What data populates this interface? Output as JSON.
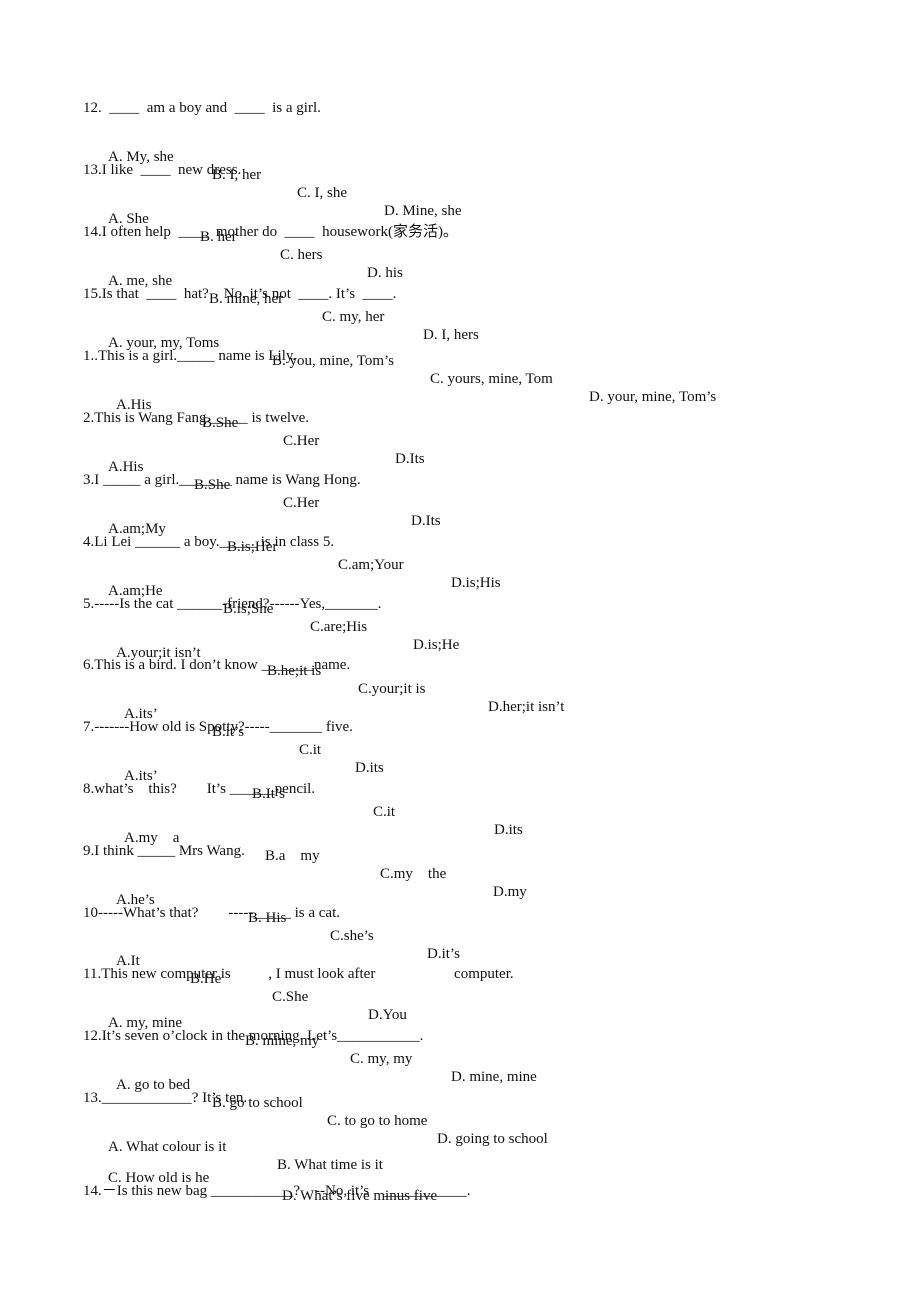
{
  "questions": [
    {
      "stem": "12.  ____  am a boy and  ____  is a girl.",
      "options": [
        "A. My, she",
        "B. I, her",
        "C. I, she",
        "D. Mine, she"
      ]
    },
    {
      "stem": "13.I like  ____  new dress.",
      "options": [
        "A. She",
        "B. her",
        "C. hers",
        "D. his"
      ]
    },
    {
      "stem": "14.I often help  ____  mother do  ____  housework(家务活)。",
      "options": [
        "A. me, she",
        "B. mine, her",
        "C. my, her",
        "D. I, hers"
      ]
    },
    {
      "stem": "15.Is that  ____  hat?    No, it’s not  ____. It’s  ____.",
      "options": [
        "A. your, my, Toms",
        "B. you, mine, Tom’s",
        "C. yours, mine, Tom",
        "D. your, mine, Tom’s"
      ]
    },
    {
      "stem": "1..This is a girl._____ name is Lily.",
      "options": [
        "A.His",
        "B.She",
        "C.Her",
        "D.Its"
      ]
    },
    {
      "stem": "2.This is Wang Fang._____ is twelve.",
      "options": [
        "A.His",
        "B.She",
        "C.Her",
        "D.Its"
      ]
    },
    {
      "stem": "3.I _____ a girl._______ name is Wang Hong.",
      "options": [
        "A.am;My",
        "B.is;Her",
        "C.am;Your",
        "D.is;His"
      ]
    },
    {
      "stem": "4.Li Lei ______ a boy._____ is in class 5.",
      "options": [
        "A.am;He",
        "B.is;She",
        "C.are;His",
        "D.is;He"
      ]
    },
    {
      "stem": "5.-----Is the cat ______-friend?------Yes,_______.",
      "options": [
        "A.your;it isn’t",
        "B.he;it is",
        "C.your;it is",
        "D.her;it isn’t"
      ]
    },
    {
      "stem": "6.This is a bird. I don’t know _______name.",
      "options": [
        "A.its’",
        "B.it’s",
        "C.it",
        "D.its"
      ]
    },
    {
      "stem": "7.-------How old is Spotty?-----_______ five.",
      "options": [
        "A.its’",
        "B.It’s",
        "C.it",
        "D.its"
      ]
    },
    {
      "stem": "8.what’s    this?        It’s ______pencil.",
      "options": [
        "A.my    a",
        "B.a    my",
        "C.my    the",
        "D.my"
      ]
    },
    {
      "stem": "9.I think _____ Mrs Wang.",
      "options": [
        "A.he’s",
        "B. His",
        "C.she’s",
        "D.it’s"
      ]
    },
    {
      "stem": "10-----What’s that?        -----_____ is a cat.",
      "options": [
        "A.It",
        "B.He",
        "C.She",
        "D.You"
      ]
    },
    {
      "stem": "11.This new computer is          , I must look after                     computer.",
      "options": [
        "A. my, mine",
        "B. mine, my",
        "C. my, my",
        "D. mine, mine"
      ]
    },
    {
      "stem": "12.It’s seven o’clock in the morning. Let’s___________.",
      "options": [
        "A. go to bed",
        "B. go to school",
        "C. to go to home",
        "D. going to school"
      ]
    },
    {
      "stem": "13.____________? It’s ten.",
      "options": [
        "A. What colour is it",
        "B. What time is it",
        "C. How old is he",
        "D. What’s five minus five"
      ]
    },
    {
      "stem": "14.－Is this new bag ___________?    --No, it’s    ___________.",
      "options": []
    }
  ]
}
